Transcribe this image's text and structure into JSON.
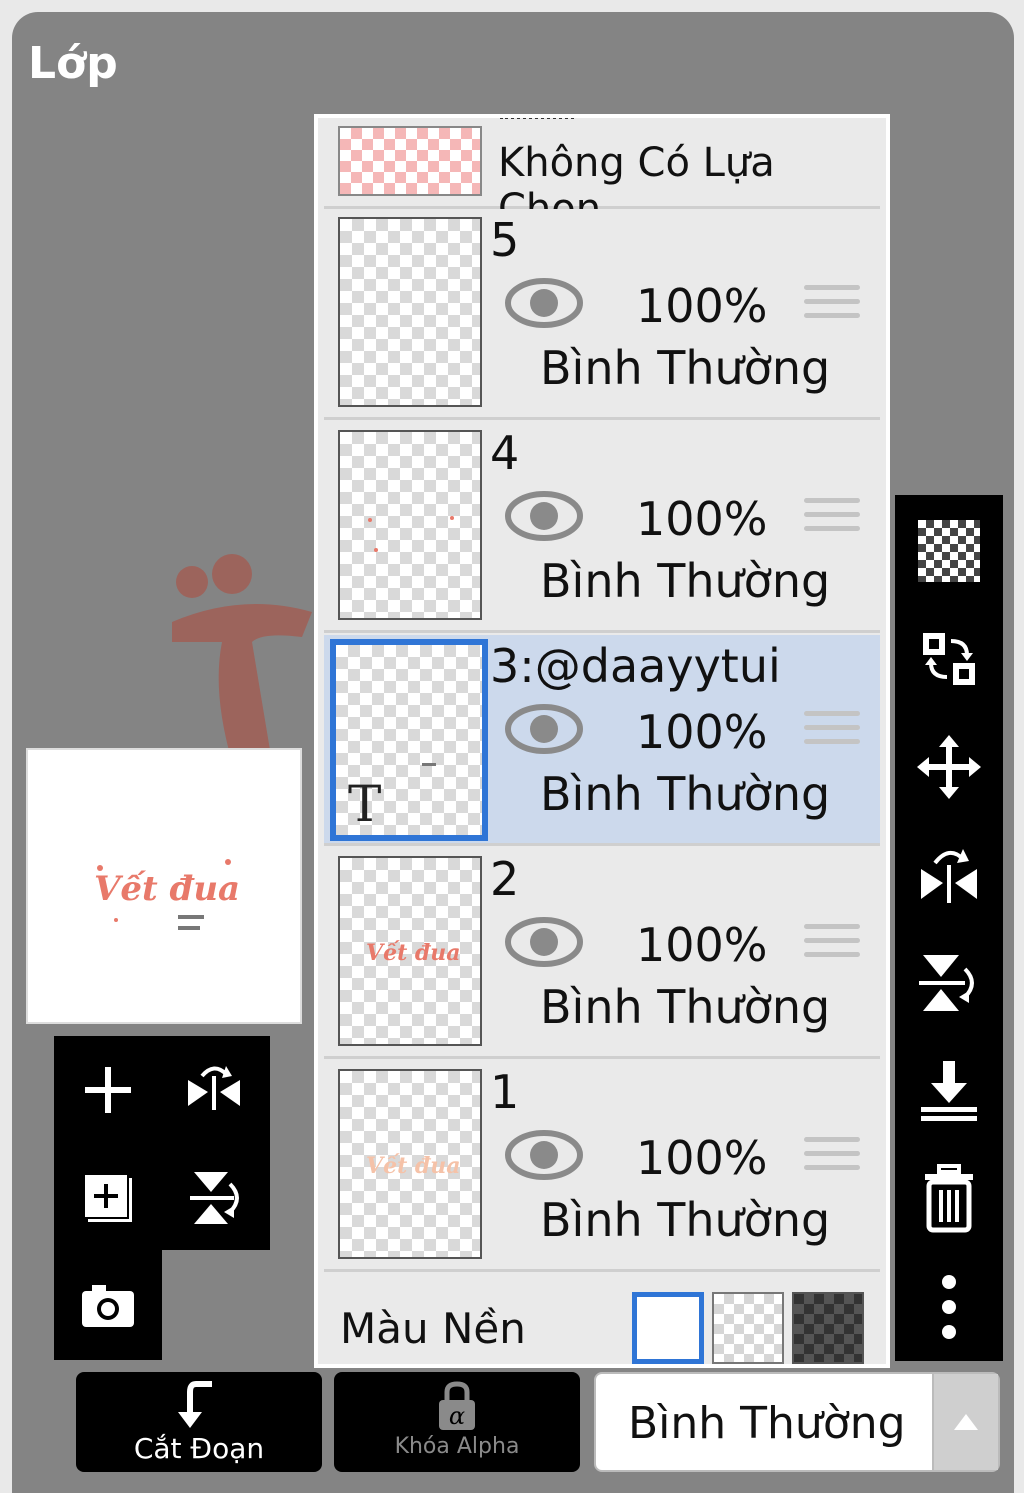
{
  "panel_title": "Lớp",
  "top_layer": {
    "label": "Không Có Lựa Chọn"
  },
  "layers": [
    {
      "name": "5",
      "opacity": "100%",
      "blend": "Bình Thường",
      "selected": false
    },
    {
      "name": "4",
      "opacity": "100%",
      "blend": "Bình Thường",
      "selected": false
    },
    {
      "name": "3:@daayytui",
      "opacity": "100%",
      "blend": "Bình Thường",
      "selected": true,
      "type_glyph": "T"
    },
    {
      "name": "2",
      "opacity": "100%",
      "blend": "Bình Thường",
      "selected": false
    },
    {
      "name": "1",
      "opacity": "100%",
      "blend": "Bình Thường",
      "selected": false
    }
  ],
  "background": {
    "label": "Màu Nền",
    "options": [
      "white",
      "transparent",
      "dark-checker"
    ],
    "selected": "white"
  },
  "bottom_bar": {
    "clip_label": "Cắt Đoạn",
    "alpha_lock_label": "Khóa Alpha",
    "blend_mode": "Bình Thường"
  },
  "colors": {
    "panel": "#848484",
    "selection": "#ccd9ec",
    "selected_border": "#2f75d6",
    "artwork": "#e8796a"
  }
}
